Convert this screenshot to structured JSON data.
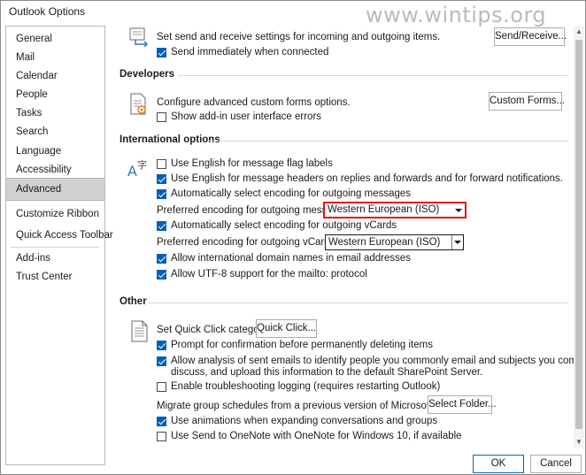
{
  "window": {
    "title": "Outlook Options",
    "watermark": "www.wintips.org"
  },
  "sidebar": {
    "items": [
      {
        "label": "General"
      },
      {
        "label": "Mail"
      },
      {
        "label": "Calendar"
      },
      {
        "label": "People"
      },
      {
        "label": "Tasks"
      },
      {
        "label": "Search"
      },
      {
        "label": "Language"
      },
      {
        "label": "Accessibility"
      },
      {
        "label": "Advanced",
        "selected": true
      },
      {
        "label": "Customize Ribbon"
      },
      {
        "label": "Quick Access Toolbar"
      },
      {
        "label": "Add-ins"
      },
      {
        "label": "Trust Center"
      }
    ]
  },
  "send_receive": {
    "description": "Set send and receive settings for incoming and outgoing items.",
    "button": "Send/Receive...",
    "send_immediately": {
      "label": "Send immediately when connected",
      "checked": true
    }
  },
  "developers": {
    "header": "Developers",
    "description": "Configure advanced custom forms options.",
    "button": "Custom Forms...",
    "show_addin_errors": {
      "label": "Show add-in user interface errors",
      "checked": false
    }
  },
  "international": {
    "header": "International options",
    "english_flag_labels": {
      "label": "Use English for message flag labels",
      "checked": false
    },
    "english_headers": {
      "label": "Use English for message headers on replies and forwards and for forward notifications.",
      "checked": true
    },
    "auto_encoding_messages": {
      "label": "Automatically select encoding for outgoing messages",
      "checked": true
    },
    "preferred_encoding_messages": {
      "label": "Preferred encoding for outgoing messages:",
      "value": "Western European (ISO)"
    },
    "auto_encoding_vcards": {
      "label": "Automatically select encoding for outgoing vCards",
      "checked": true
    },
    "preferred_encoding_vcards": {
      "label": "Preferred encoding for outgoing vCards:",
      "value": "Western European (ISO)"
    },
    "intl_domain_names": {
      "label": "Allow international domain names in email addresses",
      "checked": true
    },
    "utf8_mailto": {
      "label": "Allow UTF-8 support for the mailto: protocol",
      "checked": true
    }
  },
  "other": {
    "header": "Other",
    "quick_click": {
      "label": "Set Quick Click category:",
      "button": "Quick Click..."
    },
    "confirm_delete": {
      "label": "Prompt for confirmation before permanently deleting items",
      "checked": true
    },
    "analysis": {
      "label_line1": "Allow analysis of sent emails to identify people you commonly email and subjects you commonly",
      "label_line2": "discuss, and upload this information to the default SharePoint Server.",
      "checked": true
    },
    "troubleshooting": {
      "label": "Enable troubleshooting logging (requires restarting Outlook)",
      "checked": false
    },
    "migrate": {
      "label": "Migrate group schedules from a previous version of Microsoft Outlook:",
      "button": "Select Folder..."
    },
    "animations": {
      "label": "Use animations when expanding conversations and groups",
      "checked": true
    },
    "onenote": {
      "label": "Use Send to OneNote with OneNote for Windows 10, if available",
      "checked": false
    }
  },
  "footer": {
    "ok": "OK",
    "cancel": "Cancel"
  },
  "colors": {
    "accent": "#005fb8",
    "highlight_border": "#e3161b",
    "selected_nav": "#d1d1d1"
  }
}
